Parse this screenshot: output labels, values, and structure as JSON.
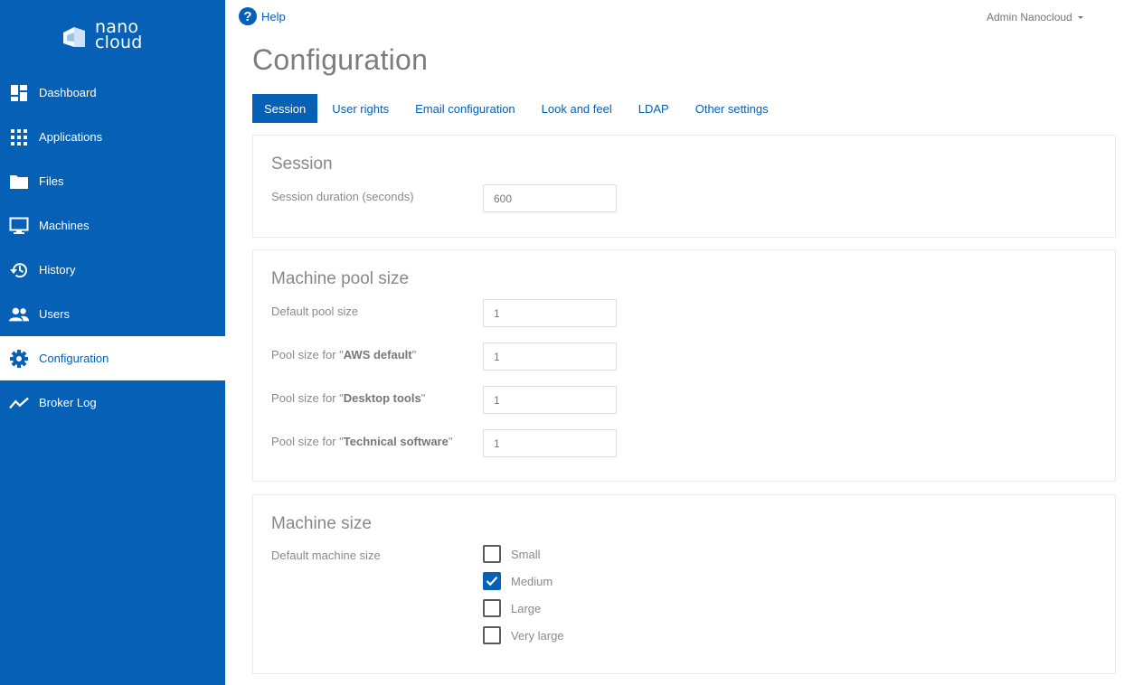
{
  "app": {
    "logo_line1": "nano",
    "logo_line2": "cloud"
  },
  "sidebar": {
    "items": [
      {
        "label": "Dashboard",
        "icon": "dashboard-icon"
      },
      {
        "label": "Applications",
        "icon": "apps-grid-icon"
      },
      {
        "label": "Files",
        "icon": "folder-icon"
      },
      {
        "label": "Machines",
        "icon": "monitor-icon"
      },
      {
        "label": "History",
        "icon": "history-icon"
      },
      {
        "label": "Users",
        "icon": "users-icon"
      },
      {
        "label": "Configuration",
        "icon": "gear-icon",
        "active": true
      },
      {
        "label": "Broker Log",
        "icon": "line-chart-icon"
      }
    ]
  },
  "header": {
    "help_label": "Help",
    "help_icon": "?",
    "user_label": "Admin Nanocloud"
  },
  "page": {
    "title": "Configuration"
  },
  "tabs": [
    {
      "label": "Session",
      "active": true
    },
    {
      "label": "User rights"
    },
    {
      "label": "Email configuration"
    },
    {
      "label": "Look and feel"
    },
    {
      "label": "LDAP"
    },
    {
      "label": "Other settings"
    }
  ],
  "session": {
    "title": "Session",
    "duration_label": "Session duration (seconds)",
    "duration_value": "600"
  },
  "pool": {
    "title": "Machine pool size",
    "default_label": "Default pool size",
    "default_value": "1",
    "label_prefix": "Pool size for \"",
    "label_suffix": "\"",
    "items": [
      {
        "name": "AWS default",
        "value": "1"
      },
      {
        "name": "Desktop tools",
        "value": "1"
      },
      {
        "name": "Technical software",
        "value": "1"
      }
    ]
  },
  "machine_size": {
    "title": "Machine size",
    "label": "Default machine size",
    "options": [
      {
        "label": "Small",
        "checked": false
      },
      {
        "label": "Medium",
        "checked": true
      },
      {
        "label": "Large",
        "checked": false
      },
      {
        "label": "Very large",
        "checked": false
      }
    ]
  },
  "colors": {
    "primary": "#0660b5",
    "sidebar_bg": "#0660b5",
    "muted_text": "#8a8a8a"
  }
}
